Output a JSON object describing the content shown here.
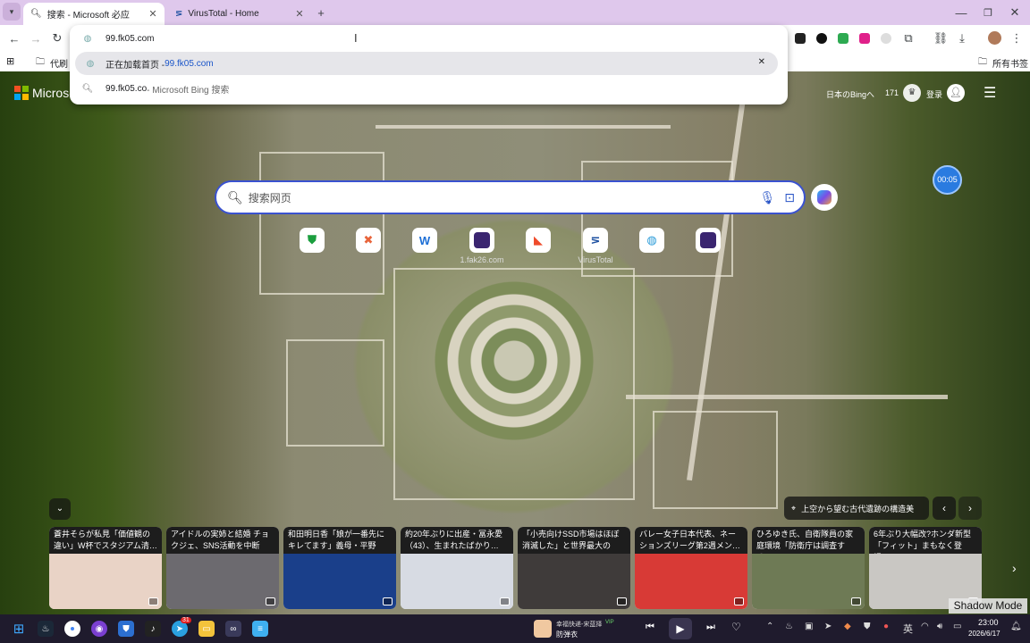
{
  "tabs": [
    {
      "title": "搜索 - Microsoft 必应",
      "active": true
    },
    {
      "title": "VirusTotal - Home",
      "active": false
    }
  ],
  "new_tab_symbol": "+",
  "window_controls": {
    "minimize": "—",
    "restore": "❐",
    "close": "✕"
  },
  "omnibox": {
    "value": "99.fk05.com",
    "suggestions": [
      {
        "text": "正在加载首页 - ",
        "highlight": "99.fk05.com",
        "icon": "globe-icon"
      },
      {
        "text": "99.fk05.co",
        "suffix": " - Microsoft Bing 搜索",
        "icon": "search-icon"
      }
    ]
  },
  "bookmarks": {
    "left_folder": "代刷",
    "right_folder": "所有书签"
  },
  "bing": {
    "logo_text": "Microsoft",
    "region_link": "日本のBingへ",
    "points": "171",
    "login": "登录",
    "search_placeholder": "搜索网页",
    "timer": "00:05",
    "quick_links": [
      {
        "label": "",
        "icon": "shield-icon",
        "color": "#1b9e3e"
      },
      {
        "label": "",
        "icon": "app-icon",
        "color": "#e8643a"
      },
      {
        "label": "",
        "icon": "w-logo-icon",
        "color": "#1d6fd6"
      },
      {
        "label": "1.fak26.com",
        "icon": "dark-app-icon",
        "color": "#3a2570"
      },
      {
        "label": "",
        "icon": "flag-icon",
        "color": "#ef4b2b"
      },
      {
        "label": "VirusTotal",
        "icon": "virustotal-icon",
        "color": "#1b4fa0"
      },
      {
        "label": "",
        "icon": "globe-icon",
        "color": "#2a9bd8"
      },
      {
        "label": "",
        "icon": "dark-app-icon",
        "color": "#3a2570"
      }
    ],
    "location_caption": "上空から望む古代遺跡の構造美",
    "news": [
      {
        "title": "蒼井そらが私見「価値観の違い」W杯でスタジアム清…",
        "img": "#e9d3c6"
      },
      {
        "title": "アイドルの実姉と結婚 チョクジェ、SNS活動を中断へ…",
        "img": "#6c6a6f"
      },
      {
        "title": "和田明日香「娘が一番先にキレてます」義母・平野レ…",
        "img": "#1a3f8a"
      },
      {
        "title": "約20年ぶりに出産・冨永愛（43）、生まれたばかり…",
        "img": "#d7dbe3"
      },
      {
        "title": "「小売向けSSD市場はほぼ消滅した」と世界最大のSSD…",
        "img": "#3f3b3a"
      },
      {
        "title": "バレー女子日本代表、ネーションズリーグ第2週メン…",
        "img": "#d83a36"
      },
      {
        "title": "ひろゆき氏、自衛隊員の家庭環境「防衛庁は調査する…",
        "img": "#6e7a55"
      },
      {
        "title": "6年ぶり大幅改?ホンダ新型「フィット」まもなく登場…",
        "img": "#c9c7c3"
      }
    ]
  },
  "overlay_badge": "Shadow Mode",
  "taskbar": {
    "media_title": "幸福快递-宋蓝择",
    "media_badge": "VIP",
    "media_artist": "防弹衣",
    "ime": "英",
    "time": "23:00",
    "date": "2026/6/17",
    "chrome_badge": "31"
  }
}
